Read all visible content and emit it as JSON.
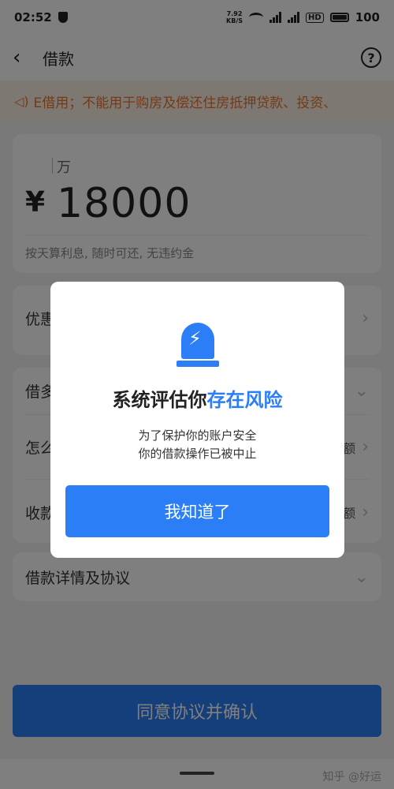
{
  "status_bar": {
    "time": "02:52",
    "net_speed_value": "7.92",
    "net_speed_unit": "KB/S",
    "battery": "100"
  },
  "header": {
    "back_icon": "chevron-left-icon",
    "title": "借款",
    "help_icon": "question-circle-icon"
  },
  "notice": {
    "speaker_icon": "speaker-icon",
    "text": "E借用；不能用于购房及偿还住房抵押贷款、投资、"
  },
  "amount": {
    "unit": "万",
    "currency": "¥",
    "value": "18000",
    "hint": "按天算利息, 随时可还, 无违约金"
  },
  "rows": {
    "discount": "优惠",
    "borrow": "借多",
    "how": "怎么",
    "receive": "收款",
    "details": "借款详情及协议",
    "how_aside": "额",
    "receive_aside": "额"
  },
  "confirm_button": "同意协议并确认",
  "watermark": "知乎 @好运",
  "dialog": {
    "icon": "alarm-lamp-icon",
    "title_main": "系统评估你",
    "title_highlight": "存在风险",
    "message_line1": "为了保护你的账户安全",
    "message_line2": "你的借款操作已被中止",
    "ok_button": "我知道了"
  },
  "colors": {
    "accent": "#2b7ef5",
    "notice_text": "#e8742e",
    "notice_bg": "#fdf0e6"
  }
}
